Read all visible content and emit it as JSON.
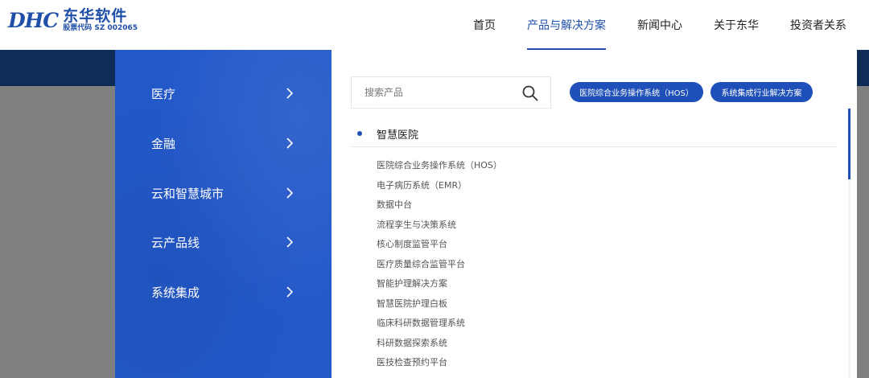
{
  "logo": {
    "mark": "DHC",
    "name": "东华软件",
    "stock_code": "股票代码 SZ 002065"
  },
  "nav": [
    {
      "label": "首页"
    },
    {
      "label": "产品与解决方案"
    },
    {
      "label": "新闻中心"
    },
    {
      "label": "关于东华"
    },
    {
      "label": "投资者关系"
    }
  ],
  "active_nav": "产品与解决方案",
  "menu": {
    "categories": [
      {
        "label": "医疗"
      },
      {
        "label": "金融"
      },
      {
        "label": "云和智慧城市"
      },
      {
        "label": "云产品线"
      },
      {
        "label": "系统集成"
      }
    ],
    "search": {
      "placeholder": "搜索产品"
    },
    "chips": [
      {
        "label": "医院综合业务操作系统（HOS）"
      },
      {
        "label": "系统集成行业解决方案"
      }
    ],
    "section_title": "智慧医院",
    "items": [
      "医院综合业务操作系统（HOS）",
      "电子病历系统（EMR）",
      "数据中台",
      "流程孪生与决策系统",
      "核心制度监管平台",
      "医疗质量综合监管平台",
      "智能护理解决方案",
      "智慧医院护理白板",
      "临床科研数据管理系统",
      "科研数据探索系统",
      "医技检查预约平台"
    ]
  },
  "colors": {
    "brand_blue": "#1f4fa8",
    "menu_blue": "#2358c9",
    "header_band": "#0d2d57",
    "overlay_gray": "#808080"
  }
}
